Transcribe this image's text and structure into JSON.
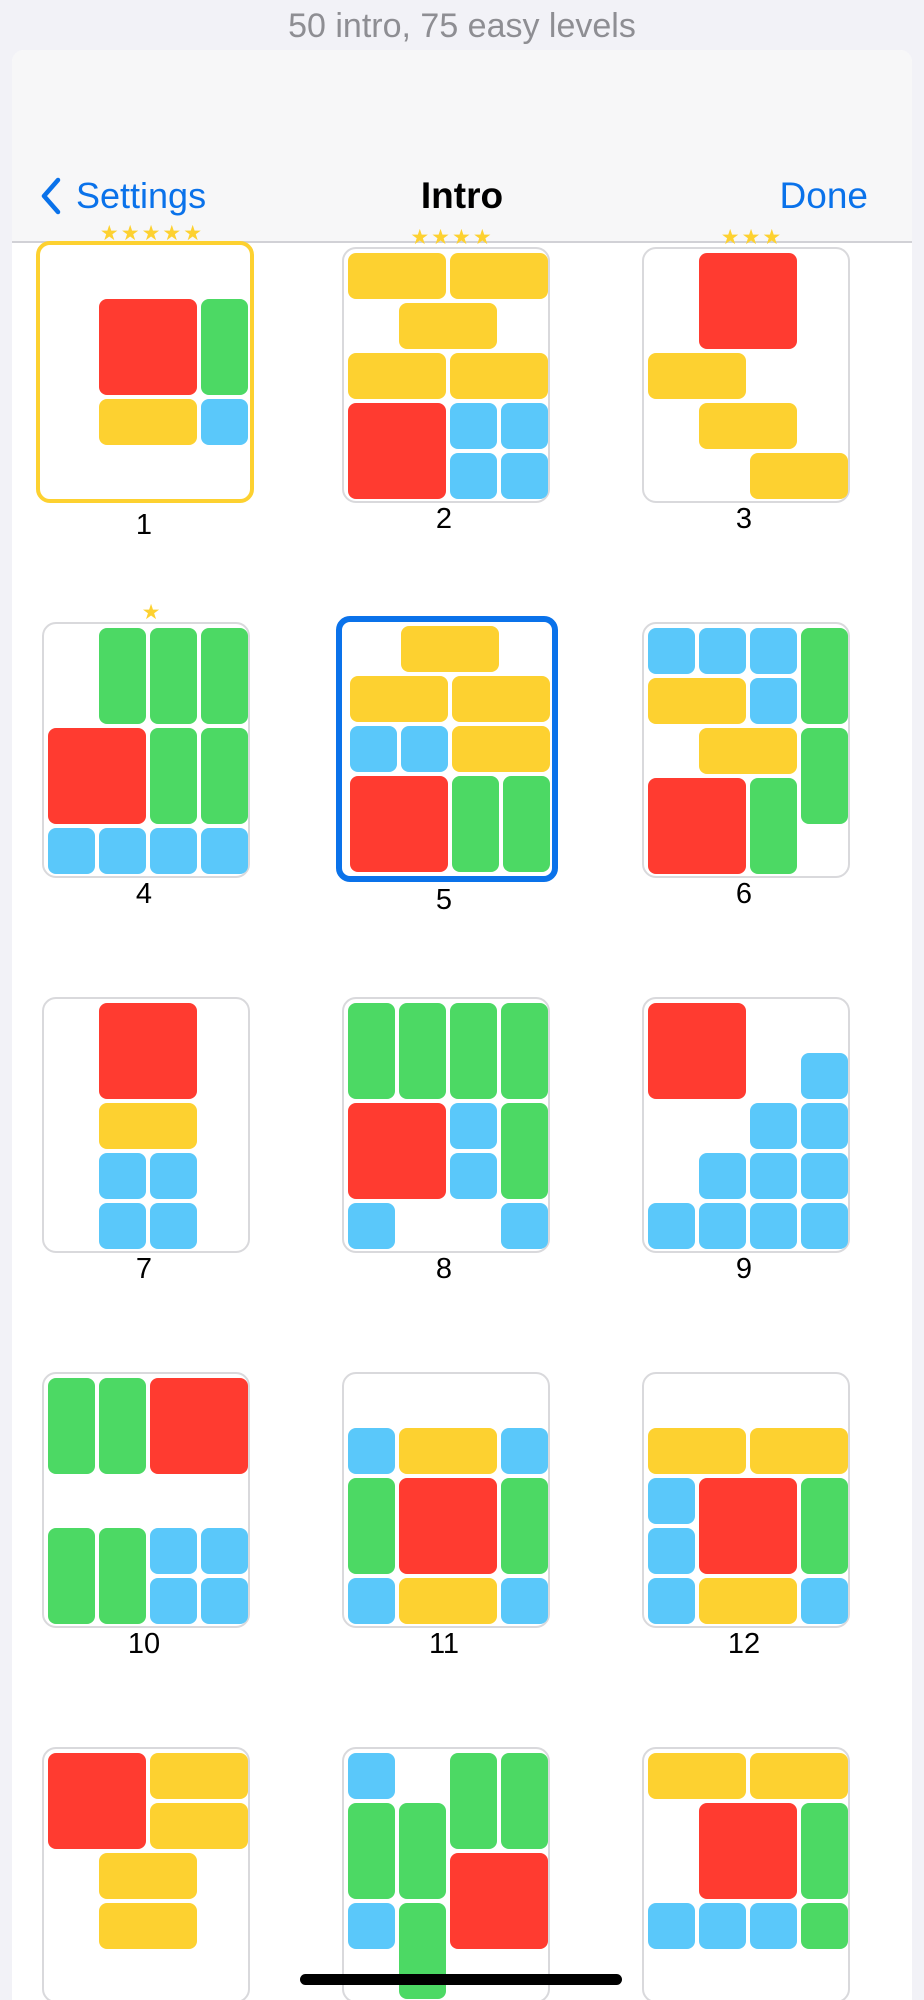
{
  "caption": "50 intro, 75 easy levels",
  "nav": {
    "back_label": "Settings",
    "title": "Intro",
    "done_label": "Done"
  },
  "colors": {
    "red": "#ff3b30",
    "yellow": "#fdd130",
    "green": "#4cd964",
    "blue": "#5ac8fa",
    "accent": "#0a72ea"
  },
  "levels": [
    {
      "number": "1",
      "stars": "★★★★★",
      "rating": 5,
      "state": "golden",
      "pieces": [
        [
          "red",
          1,
          1,
          2,
          2
        ],
        [
          "green",
          3,
          1,
          1,
          2
        ],
        [
          "yellow",
          1,
          3,
          2,
          1
        ],
        [
          "blue",
          3,
          3,
          1,
          1
        ]
      ]
    },
    {
      "number": "2",
      "stars": "★★★★",
      "rating": 4,
      "state": "normal",
      "pieces": [
        [
          "yellow",
          0,
          0,
          2,
          1
        ],
        [
          "yellow",
          2,
          0,
          2,
          1
        ],
        [
          "yellow",
          1,
          1,
          2,
          1
        ],
        [
          "yellow",
          0,
          2,
          2,
          1
        ],
        [
          "yellow",
          2,
          2,
          2,
          1
        ],
        [
          "red",
          0,
          3,
          2,
          2
        ],
        [
          "blue",
          2,
          3,
          1,
          1
        ],
        [
          "blue",
          3,
          3,
          1,
          1
        ],
        [
          "blue",
          2,
          4,
          1,
          1
        ],
        [
          "blue",
          3,
          4,
          1,
          1
        ]
      ]
    },
    {
      "number": "3",
      "stars": "★★★",
      "rating": 3,
      "state": "normal",
      "pieces": [
        [
          "red",
          1,
          0,
          2,
          2
        ],
        [
          "yellow",
          0,
          2,
          2,
          1
        ],
        [
          "yellow",
          1,
          3,
          2,
          1
        ],
        [
          "yellow",
          2,
          4,
          2,
          1
        ]
      ]
    },
    {
      "number": "4",
      "stars": "★",
      "rating": 1,
      "state": "normal",
      "pieces": [
        [
          "green",
          1,
          0,
          1,
          2
        ],
        [
          "green",
          2,
          0,
          1,
          2
        ],
        [
          "green",
          3,
          0,
          1,
          2
        ],
        [
          "red",
          0,
          2,
          2,
          2
        ],
        [
          "green",
          2,
          2,
          1,
          2
        ],
        [
          "green",
          3,
          2,
          1,
          2
        ],
        [
          "blue",
          0,
          4,
          1,
          1
        ],
        [
          "blue",
          1,
          4,
          1,
          1
        ],
        [
          "blue",
          2,
          4,
          1,
          1
        ],
        [
          "blue",
          3,
          4,
          1,
          1
        ]
      ]
    },
    {
      "number": "5",
      "stars": "",
      "rating": 0,
      "state": "current",
      "pieces": [
        [
          "yellow",
          1,
          0,
          2,
          1
        ],
        [
          "yellow",
          0,
          1,
          2,
          1
        ],
        [
          "yellow",
          2,
          1,
          2,
          1
        ],
        [
          "blue",
          0,
          2,
          1,
          1
        ],
        [
          "blue",
          1,
          2,
          1,
          1
        ],
        [
          "yellow",
          2,
          2,
          2,
          1
        ],
        [
          "red",
          0,
          3,
          2,
          2
        ],
        [
          "green",
          2,
          3,
          1,
          2
        ],
        [
          "green",
          3,
          3,
          1,
          2
        ]
      ]
    },
    {
      "number": "6",
      "stars": "",
      "rating": 0,
      "state": "normal",
      "pieces": [
        [
          "blue",
          0,
          0,
          1,
          1
        ],
        [
          "blue",
          1,
          0,
          1,
          1
        ],
        [
          "blue",
          2,
          0,
          1,
          1
        ],
        [
          "green",
          3,
          0,
          1,
          2
        ],
        [
          "yellow",
          0,
          1,
          2,
          1
        ],
        [
          "blue",
          2,
          1,
          1,
          1
        ],
        [
          "yellow",
          1,
          2,
          2,
          1
        ],
        [
          "green",
          3,
          2,
          1,
          2
        ],
        [
          "red",
          0,
          3,
          2,
          2
        ],
        [
          "green",
          2,
          3,
          1,
          2
        ]
      ]
    },
    {
      "number": "7",
      "stars": "",
      "rating": 0,
      "state": "normal",
      "pieces": [
        [
          "red",
          1,
          0,
          2,
          2
        ],
        [
          "yellow",
          1,
          2,
          2,
          1
        ],
        [
          "blue",
          1,
          3,
          1,
          1
        ],
        [
          "blue",
          2,
          3,
          1,
          1
        ],
        [
          "blue",
          1,
          4,
          1,
          1
        ],
        [
          "blue",
          2,
          4,
          1,
          1
        ]
      ]
    },
    {
      "number": "8",
      "stars": "",
      "rating": 0,
      "state": "normal",
      "pieces": [
        [
          "green",
          0,
          0,
          1,
          2
        ],
        [
          "green",
          1,
          0,
          1,
          2
        ],
        [
          "green",
          2,
          0,
          1,
          2
        ],
        [
          "green",
          3,
          0,
          1,
          2
        ],
        [
          "red",
          0,
          2,
          2,
          2
        ],
        [
          "blue",
          2,
          2,
          1,
          1
        ],
        [
          "green",
          3,
          2,
          1,
          2
        ],
        [
          "blue",
          2,
          3,
          1,
          1
        ],
        [
          "blue",
          0,
          4,
          1,
          1
        ],
        [
          "blue",
          3,
          4,
          1,
          1
        ]
      ]
    },
    {
      "number": "9",
      "stars": "",
      "rating": 0,
      "state": "normal",
      "pieces": [
        [
          "red",
          0,
          0,
          2,
          2
        ],
        [
          "blue",
          3,
          1,
          1,
          1
        ],
        [
          "blue",
          2,
          2,
          1,
          1
        ],
        [
          "blue",
          3,
          2,
          1,
          1
        ],
        [
          "blue",
          1,
          3,
          1,
          1
        ],
        [
          "blue",
          2,
          3,
          1,
          1
        ],
        [
          "blue",
          3,
          3,
          1,
          1
        ],
        [
          "blue",
          0,
          4,
          1,
          1
        ],
        [
          "blue",
          1,
          4,
          1,
          1
        ],
        [
          "blue",
          2,
          4,
          1,
          1
        ],
        [
          "blue",
          3,
          4,
          1,
          1
        ]
      ]
    },
    {
      "number": "10",
      "stars": "",
      "rating": 0,
      "state": "normal",
      "pieces": [
        [
          "green",
          0,
          0,
          1,
          2
        ],
        [
          "green",
          1,
          0,
          1,
          2
        ],
        [
          "red",
          2,
          0,
          2,
          2
        ],
        [
          "green",
          0,
          3,
          1,
          2
        ],
        [
          "green",
          1,
          3,
          1,
          2
        ],
        [
          "blue",
          2,
          3,
          1,
          1
        ],
        [
          "blue",
          3,
          3,
          1,
          1
        ],
        [
          "blue",
          2,
          4,
          1,
          1
        ],
        [
          "blue",
          3,
          4,
          1,
          1
        ]
      ]
    },
    {
      "number": "11",
      "stars": "",
      "rating": 0,
      "state": "normal",
      "pieces": [
        [
          "blue",
          0,
          1,
          1,
          1
        ],
        [
          "yellow",
          1,
          1,
          2,
          1
        ],
        [
          "blue",
          3,
          1,
          1,
          1
        ],
        [
          "green",
          0,
          2,
          1,
          2
        ],
        [
          "red",
          1,
          2,
          2,
          2
        ],
        [
          "green",
          3,
          2,
          1,
          2
        ],
        [
          "blue",
          0,
          4,
          1,
          1
        ],
        [
          "yellow",
          1,
          4,
          2,
          1
        ],
        [
          "blue",
          3,
          4,
          1,
          1
        ]
      ]
    },
    {
      "number": "12",
      "stars": "",
      "rating": 0,
      "state": "normal",
      "pieces": [
        [
          "yellow",
          0,
          1,
          2,
          1
        ],
        [
          "yellow",
          2,
          1,
          2,
          1
        ],
        [
          "blue",
          0,
          2,
          1,
          1
        ],
        [
          "red",
          1,
          2,
          2,
          2
        ],
        [
          "green",
          3,
          2,
          1,
          2
        ],
        [
          "blue",
          0,
          3,
          1,
          1
        ],
        [
          "blue",
          0,
          4,
          1,
          1
        ],
        [
          "yellow",
          1,
          4,
          2,
          1
        ],
        [
          "blue",
          3,
          4,
          1,
          1
        ]
      ]
    },
    {
      "number": "",
      "stars": "",
      "rating": 0,
      "state": "normal",
      "pieces": [
        [
          "red",
          0,
          0,
          2,
          2
        ],
        [
          "yellow",
          2,
          0,
          2,
          1
        ],
        [
          "yellow",
          2,
          1,
          2,
          1
        ],
        [
          "yellow",
          1,
          2,
          2,
          1
        ],
        [
          "yellow",
          1,
          3,
          2,
          1
        ]
      ]
    },
    {
      "number": "",
      "stars": "",
      "rating": 0,
      "state": "normal",
      "pieces": [
        [
          "blue",
          0,
          0,
          1,
          1
        ],
        [
          "green",
          2,
          0,
          1,
          2
        ],
        [
          "green",
          3,
          0,
          1,
          2
        ],
        [
          "green",
          0,
          1,
          1,
          2
        ],
        [
          "green",
          1,
          1,
          1,
          2
        ],
        [
          "red",
          2,
          2,
          2,
          2
        ],
        [
          "blue",
          0,
          3,
          1,
          1
        ],
        [
          "green",
          1,
          3,
          1,
          2
        ]
      ]
    },
    {
      "number": "",
      "stars": "",
      "rating": 0,
      "state": "normal",
      "pieces": [
        [
          "yellow",
          0,
          0,
          2,
          1
        ],
        [
          "yellow",
          2,
          0,
          2,
          1
        ],
        [
          "red",
          1,
          1,
          2,
          2
        ],
        [
          "green",
          3,
          1,
          1,
          2
        ],
        [
          "blue",
          0,
          3,
          1,
          1
        ],
        [
          "blue",
          1,
          3,
          1,
          1
        ],
        [
          "blue",
          2,
          3,
          1,
          1
        ],
        [
          "green",
          3,
          3,
          1,
          1
        ]
      ]
    }
  ]
}
